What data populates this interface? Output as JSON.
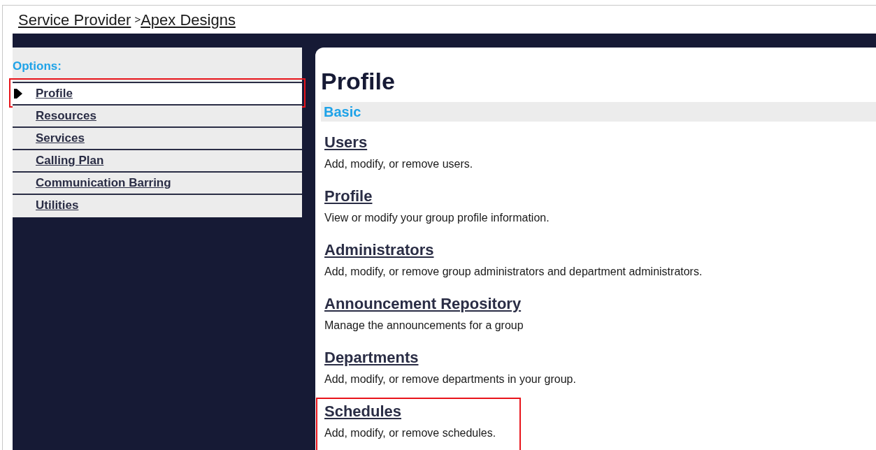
{
  "breadcrumb": [
    {
      "label": "Service Provider"
    },
    {
      "label": "Apex Designs",
      "separator": ">"
    }
  ],
  "sidebar": {
    "title": "Options:",
    "items": [
      {
        "label": "Profile",
        "selected": true,
        "highlighted": true
      },
      {
        "label": "Resources",
        "selected": false,
        "highlighted": false
      },
      {
        "label": "Services",
        "selected": false,
        "highlighted": false
      },
      {
        "label": "Calling Plan",
        "selected": false,
        "highlighted": false
      },
      {
        "label": "Communication Barring",
        "selected": false,
        "highlighted": false
      },
      {
        "label": "Utilities",
        "selected": false,
        "highlighted": false
      }
    ]
  },
  "content": {
    "title": "Profile",
    "section": "Basic",
    "items": [
      {
        "title": "Users",
        "description": "Add, modify, or remove users.",
        "highlighted": false
      },
      {
        "title": "Profile",
        "description": "View or modify your group profile information.",
        "highlighted": false
      },
      {
        "title": "Administrators",
        "description": "Add, modify, or remove group administrators and department administrators.",
        "highlighted": false
      },
      {
        "title": "Announcement Repository",
        "description": "Manage the announcements for a group",
        "highlighted": false
      },
      {
        "title": "Departments",
        "description": "Add, modify, or remove departments in your group.",
        "highlighted": false
      },
      {
        "title": "Schedules",
        "description": "Add, modify, or remove schedules.",
        "highlighted": true
      }
    ]
  }
}
